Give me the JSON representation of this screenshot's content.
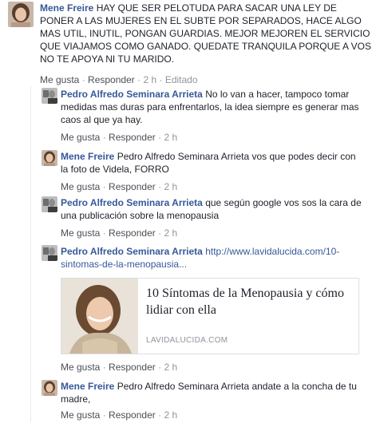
{
  "comments": [
    {
      "author": "Mene Freire",
      "text": "HAY QUE SER PELOTUDA PARA SACAR UNA LEY DE PONER A LAS MUJERES EN EL SUBTE POR SEPARADOS, HACE ALGO MAS UTIL, INUTIL, PONGAN GUARDIAS. MEJOR MEJOREN EL SERVICIO QUE VIAJAMOS COMO GANADO. QUEDATE TRANQUILA PORQUE A VOS NO TE APOYA NI TU MARIDO.",
      "like": "Me gusta",
      "reply": "Responder",
      "time": "2 h",
      "edited": "Editado"
    },
    {
      "author": "Pedro Alfredo Seminara Arrieta",
      "text": "No lo van a hacer, tampoco tomar medidas mas duras para enfrentarlos, la idea siempre es generar mas caos al que ya hay.",
      "like": "Me gusta",
      "reply": "Responder",
      "time": "2 h"
    },
    {
      "author": "Mene Freire",
      "text": "Pedro Alfredo Seminara Arrieta vos que podes decir con la foto de Videla, FORRO",
      "like": "Me gusta",
      "reply": "Responder",
      "time": "2 h"
    },
    {
      "author": "Pedro Alfredo Seminara Arrieta",
      "text": "que según google vos sos la cara de una publicación sobre la menopausia",
      "like": "Me gusta",
      "reply": "Responder",
      "time": "2 h"
    },
    {
      "author": "Pedro Alfredo Seminara Arrieta",
      "link": "http://www.lavidalucida.com/10-sintomas-de-la-menopausia...",
      "like": "Me gusta",
      "reply": "Responder",
      "time": "2 h"
    },
    {
      "author": "Mene Freire",
      "text": "Pedro Alfredo Seminara Arrieta andate a la concha de tu madre,",
      "like": "Me gusta",
      "reply": "Responder",
      "time": "2 h"
    }
  ],
  "preview": {
    "title": "10 Síntomas de la Menopausia y cómo lidiar con ella",
    "domain": "LAVIDALUCIDA.COM"
  },
  "separator": "·"
}
